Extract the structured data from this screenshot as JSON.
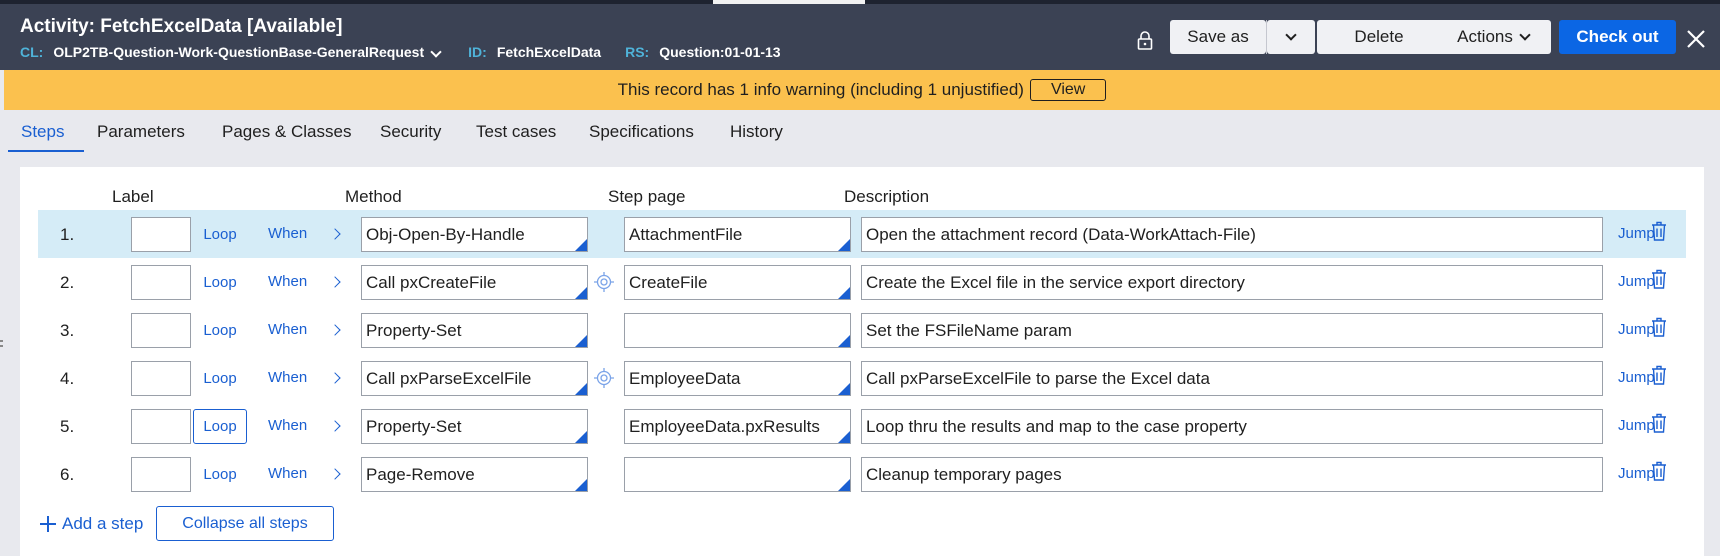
{
  "header": {
    "title": "Activity: FetchExcelData [Available]",
    "cl_key": "CL:",
    "cl_value": "OLP2TB-Question-Work-QuestionBase-GeneralRequest",
    "id_key": "ID:",
    "id_value": "FetchExcelData",
    "rs_key": "RS:",
    "rs_value": "Question:01-01-13",
    "lock_icon": "lock-icon",
    "save_as": "Save as",
    "delete": "Delete",
    "actions": "Actions",
    "check_out": "Check out",
    "primary_color": "#0b66e4",
    "header_color": "#3b4254"
  },
  "warning": {
    "message": "This record has 1 info warning (including 1 unjustified)",
    "view": "View",
    "color": "#fbc14e"
  },
  "tabs": [
    {
      "label": "Steps",
      "active": true
    },
    {
      "label": "Parameters"
    },
    {
      "label": "Pages & Classes"
    },
    {
      "label": "Security"
    },
    {
      "label": "Test cases"
    },
    {
      "label": "Specifications"
    },
    {
      "label": "History"
    }
  ],
  "columns": {
    "label": "Label",
    "method": "Method",
    "step_page": "Step page",
    "description": "Description"
  },
  "links": {
    "loop": "Loop",
    "when": "When",
    "jump": "Jump"
  },
  "steps": [
    {
      "num": "1.",
      "method": "Obj-Open-By-Handle",
      "step_page": "AttachmentFile",
      "description": "Open the attachment record (Data-WorkAttach-File)"
    },
    {
      "num": "2.",
      "method": "Call pxCreateFile",
      "step_page": "CreateFile",
      "description": "Create the Excel file in the service export directory"
    },
    {
      "num": "3.",
      "method": "Property-Set",
      "step_page": "",
      "description": "Set the FSFileName param"
    },
    {
      "num": "4.",
      "method": "Call pxParseExcelFile",
      "step_page": "EmployeeData",
      "description": "Call pxParseExcelFile to parse the Excel data"
    },
    {
      "num": "5.",
      "method": "Property-Set",
      "step_page": "EmployeeData.pxResults",
      "description": "Loop thru the results and map to the case property"
    },
    {
      "num": "6.",
      "method": "Page-Remove",
      "step_page": "",
      "description": "Cleanup temporary pages"
    }
  ],
  "footer": {
    "add_step": "Add a step",
    "collapse_all": "Collapse all steps"
  }
}
